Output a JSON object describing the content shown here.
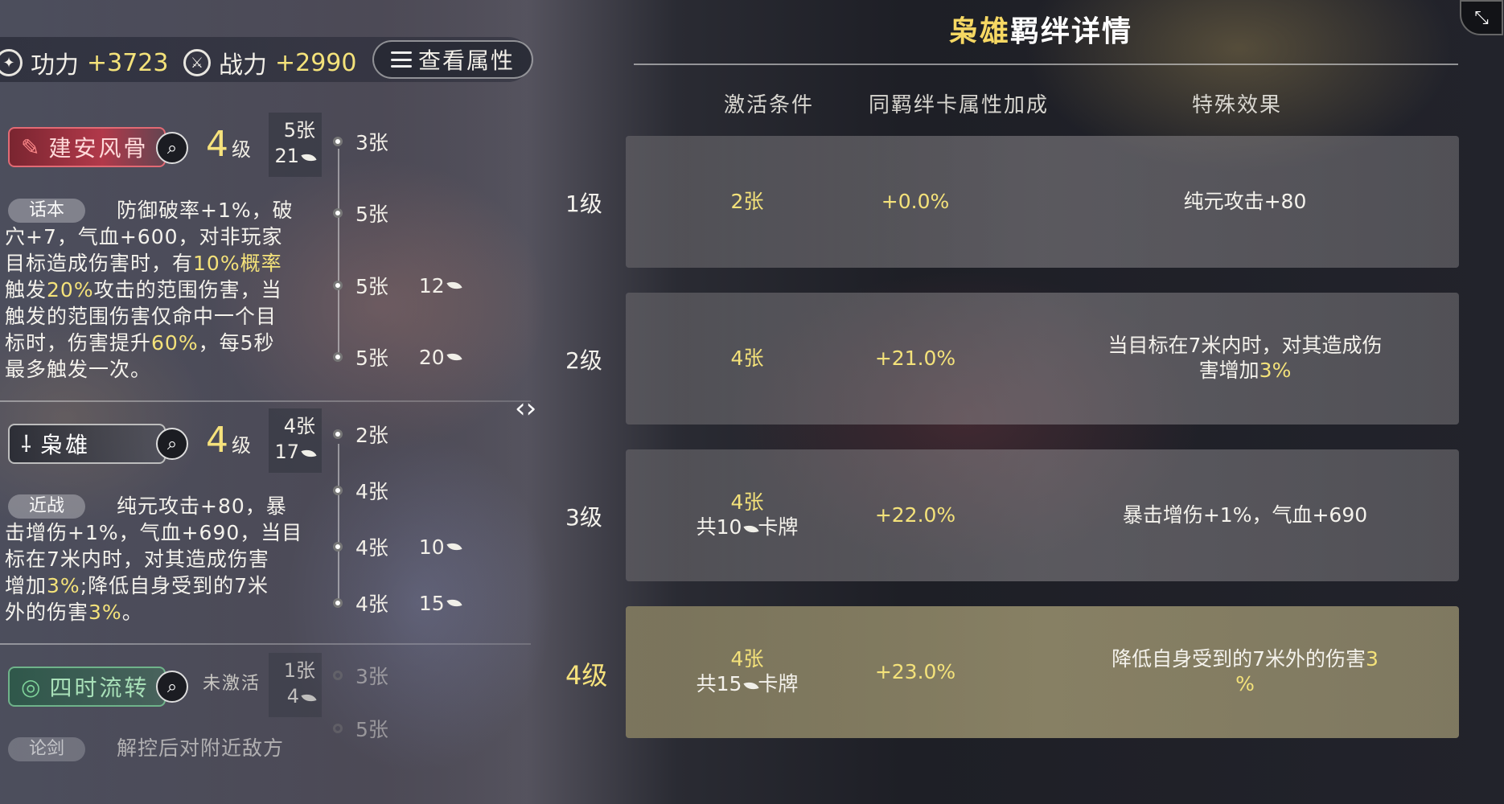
{
  "stats": {
    "power_label": "功力",
    "power_value": "+3723",
    "combat_label": "战力",
    "combat_value": "+2990",
    "view_attr_label": "查看属性"
  },
  "bonds": [
    {
      "name": "建安风骨",
      "level": "4",
      "level_unit": "级",
      "count": "5张",
      "leaves": "21",
      "category": "话本",
      "tiers": [
        {
          "cards": "3张",
          "cost": ""
        },
        {
          "cards": "5张",
          "cost": ""
        },
        {
          "cards": "5张",
          "cost": "12"
        },
        {
          "cards": "5张",
          "cost": "20"
        }
      ]
    },
    {
      "name": "枭雄",
      "level": "4",
      "level_unit": "级",
      "count": "4张",
      "leaves": "17",
      "category": "近战",
      "tiers": [
        {
          "cards": "2张",
          "cost": ""
        },
        {
          "cards": "4张",
          "cost": ""
        },
        {
          "cards": "4张",
          "cost": "10"
        },
        {
          "cards": "4张",
          "cost": "15"
        }
      ]
    },
    {
      "name": "四时流转",
      "status": "未激活",
      "count": "1张",
      "leaves": "4",
      "category": "论剑",
      "desc": "解控后对附近敌方",
      "tiers": [
        {
          "cards": "3张",
          "cost": ""
        },
        {
          "cards": "5张",
          "cost": ""
        }
      ]
    }
  ],
  "bond1_desc": {
    "a": "防御破率+1%，破",
    "b": "穴+7，气血+600，对非玩家",
    "c": "目标造成伤害时，有",
    "c_hl": "10%概率",
    "d_hl": "20%",
    "d_pre": "触发",
    "d": "攻击的范围伤害，当",
    "e": "触发的范围伤害仅命中一个目",
    "f": "标时，伤害提升",
    "f_hl": "60%",
    "f_end": "，每5秒",
    "g": "最多触发一次。"
  },
  "bond2_desc": {
    "a": "纯元攻击+80，暴",
    "b": "击增伤+1%，气血+690，当目",
    "c": "标在7米内时，对其造成伤害",
    "d_pre": "增加",
    "d_hl": "3%",
    "d": ";降低自身受到的7米",
    "e_pre": "外的伤害",
    "e_hl": "3%",
    "e": "。"
  },
  "detail": {
    "title_highlight": "枭雄",
    "title_rest": "羁绊详情",
    "col_condition": "激活条件",
    "col_bonus": "同羁绊卡属性加成",
    "col_effect": "特殊效果",
    "rows": [
      {
        "level": "1级",
        "cond": "2张",
        "cond2": "",
        "bonus": "+0.0%",
        "effect": "纯元攻击+80",
        "effect2": ""
      },
      {
        "level": "2级",
        "cond": "4张",
        "cond2": "",
        "bonus": "+21.0%",
        "effect": "当目标在7米内时，对其造成伤",
        "effect2_pre": "害增加",
        "effect2_hl": "3%"
      },
      {
        "level": "3级",
        "cond": "4张",
        "cond2_pre": "共10",
        "cond2_post": "卡牌",
        "bonus": "+22.0%",
        "effect": "暴击增伤+1%，气血+690",
        "effect2": ""
      },
      {
        "level": "4级",
        "cond": "4张",
        "cond2_pre": "共15",
        "cond2_post": "卡牌",
        "bonus": "+23.0%",
        "effect_pre": "降低自身受到的7米外的伤害",
        "effect_hl": "3",
        "effect2_hl": "%"
      }
    ]
  }
}
